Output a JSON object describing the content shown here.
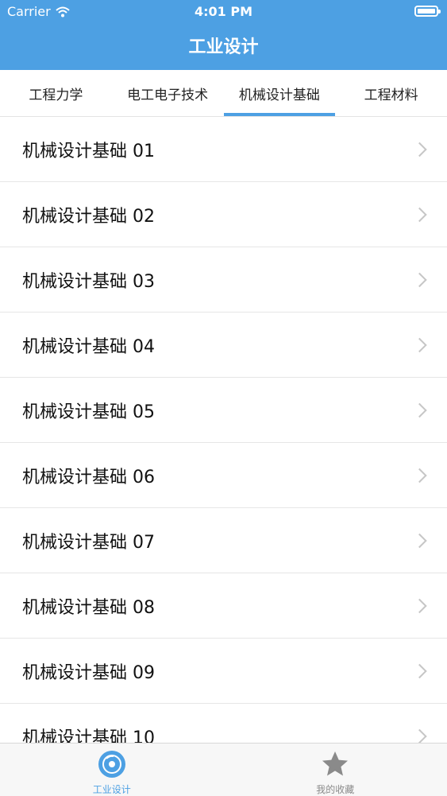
{
  "status": {
    "carrier": "Carrier",
    "time": "4:01 PM"
  },
  "nav": {
    "title": "工业设计"
  },
  "tabs": [
    {
      "label": "工程力学",
      "active": false
    },
    {
      "label": "电工电子技术",
      "active": false
    },
    {
      "label": "机械设计基础",
      "active": true
    },
    {
      "label": "工程材料",
      "active": false
    }
  ],
  "list": [
    "机械设计基础 01",
    "机械设计基础 02",
    "机械设计基础 03",
    "机械设计基础 04",
    "机械设计基础 05",
    "机械设计基础 06",
    "机械设计基础 07",
    "机械设计基础 08",
    "机械设计基础 09",
    "机械设计基础 10"
  ],
  "tabbar": [
    {
      "label": "工业设计",
      "icon": "disc-icon",
      "active": true
    },
    {
      "label": "我的收藏",
      "icon": "star-icon",
      "active": false
    }
  ],
  "colors": {
    "accent": "#4da0e3",
    "inactive": "#8a8a8a"
  }
}
